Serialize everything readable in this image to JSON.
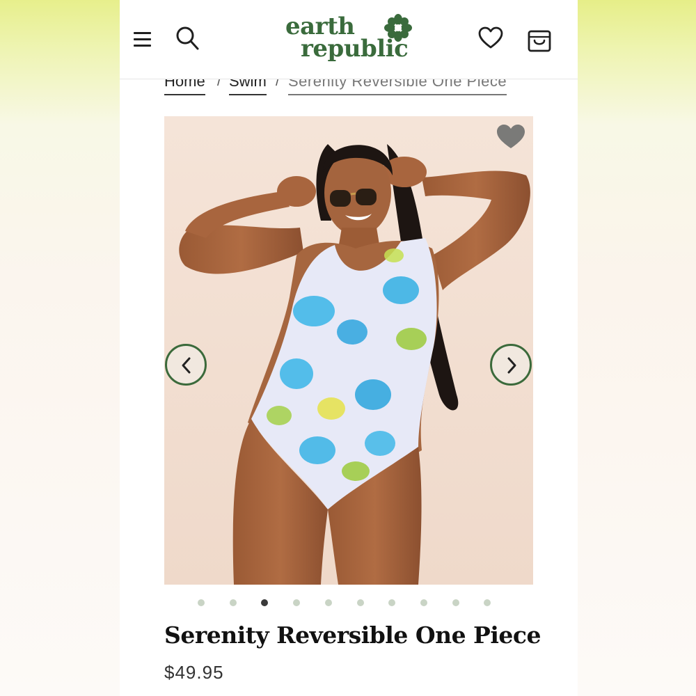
{
  "header": {
    "logo_line1": "earth",
    "logo_line2": "republic"
  },
  "breadcrumb": {
    "items": [
      "Home",
      "Swim",
      "Serenity Reversible One Piece"
    ],
    "separator": "/"
  },
  "gallery": {
    "image_count": 10,
    "active_index": 2
  },
  "product": {
    "title": "Serenity Reversible One Piece",
    "price": "$49.95"
  },
  "colors": {
    "brand_green": "#3a6b3c",
    "accent_green": "#3b6a3b",
    "background": "#ffffff"
  },
  "icons": {
    "menu": "hamburger-icon",
    "search": "search-icon",
    "wishlist": "heart-icon",
    "cart": "shopping-bag-icon",
    "favorite": "heart-filled-icon",
    "prev": "chevron-left-icon",
    "next": "chevron-right-icon"
  }
}
